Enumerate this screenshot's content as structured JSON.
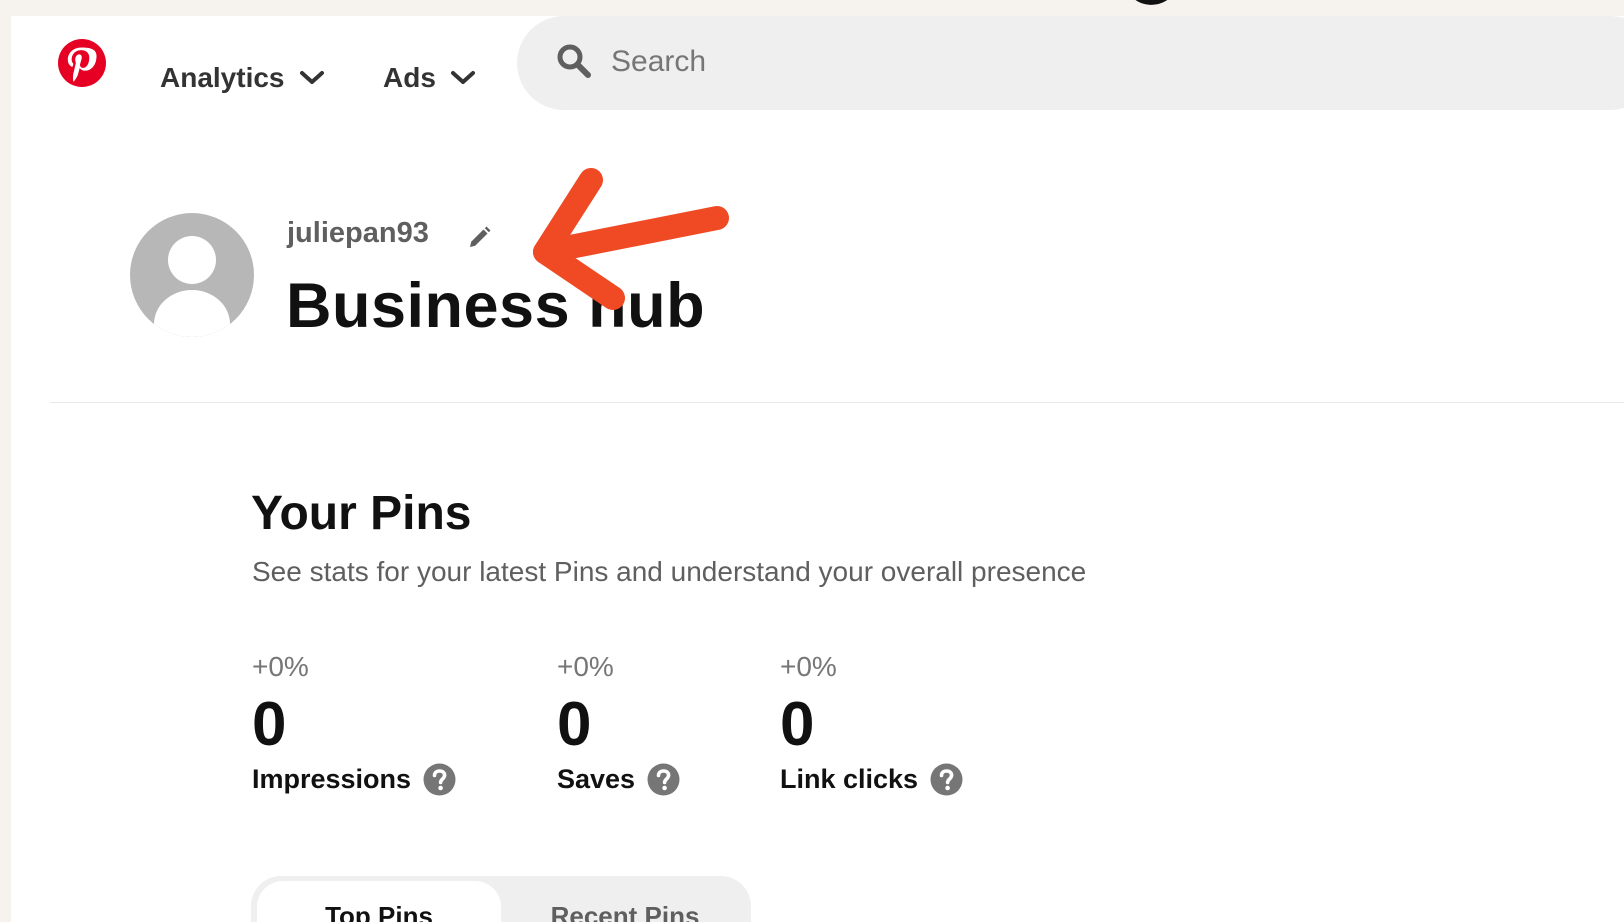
{
  "colors": {
    "brand_red": "#e60023",
    "annotation_arrow": "#ef4a24",
    "search_bg": "#efefef",
    "text_primary": "#111111",
    "text_secondary": "#5f5f5f",
    "page_backdrop": "#f6f3ee"
  },
  "nav": {
    "logo_icon": "pinterest-logo-icon",
    "items": [
      {
        "label": "Analytics",
        "icon": "chevron-down-icon"
      },
      {
        "label": "Ads",
        "icon": "chevron-down-icon"
      }
    ],
    "search": {
      "placeholder": "Search",
      "icon": "search-icon"
    }
  },
  "profile": {
    "username": "juliepan93",
    "edit_icon": "pencil-icon",
    "avatar_icon": "default-avatar-icon",
    "page_title": "Business hub"
  },
  "pins_section": {
    "title": "Your Pins",
    "subtitle": "See stats for your latest Pins and understand your overall presence",
    "stats": [
      {
        "change": "+0%",
        "value": "0",
        "label": "Impressions",
        "icon": "help-icon"
      },
      {
        "change": "+0%",
        "value": "0",
        "label": "Saves",
        "icon": "help-icon"
      },
      {
        "change": "+0%",
        "value": "0",
        "label": "Link clicks",
        "icon": "help-icon"
      }
    ],
    "tabs": [
      {
        "label": "Top Pins",
        "selected": true
      },
      {
        "label": "Recent Pins",
        "selected": false
      }
    ]
  }
}
